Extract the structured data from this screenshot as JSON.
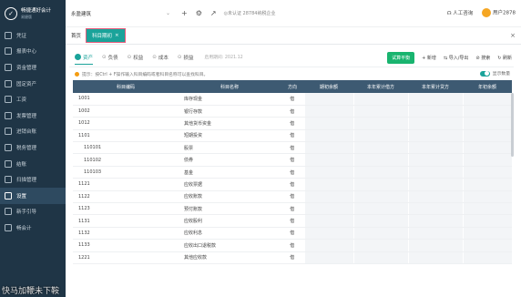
{
  "app": {
    "logo_title": "畅捷通好会计",
    "logo_sub": "易捷版"
  },
  "sidebar": {
    "items": [
      {
        "label": "凭证",
        "icon": "voucher-icon",
        "active": false
      },
      {
        "label": "报表中心",
        "icon": "report-icon",
        "active": false
      },
      {
        "label": "资金管理",
        "icon": "fund-icon",
        "active": false
      },
      {
        "label": "固定资产",
        "icon": "asset-icon",
        "active": false
      },
      {
        "label": "工资",
        "icon": "salary-icon",
        "active": false
      },
      {
        "label": "发票管理",
        "icon": "invoice-icon",
        "active": false
      },
      {
        "label": "进销台账",
        "icon": "ledger-icon",
        "active": false
      },
      {
        "label": "税务管理",
        "icon": "tax-icon",
        "active": false
      },
      {
        "label": "结账",
        "icon": "close-books-icon",
        "active": false
      },
      {
        "label": "扫描管理",
        "icon": "scan-icon",
        "active": false
      },
      {
        "label": "设置",
        "icon": "settings-icon",
        "active": true
      },
      {
        "label": "新手引导",
        "icon": "guide-icon",
        "active": false
      },
      {
        "label": "畅会计",
        "icon": "brand-icon",
        "active": false
      }
    ]
  },
  "topbar": {
    "company": "永盈建筑",
    "cert_text": "◎未认证 28784纳税企业",
    "support": "人工咨询",
    "user": "用户2878"
  },
  "tabs": {
    "home": "首页",
    "active": "科目期初",
    "close": "×"
  },
  "categories": {
    "items": [
      "资产",
      "负债",
      "权益",
      "成本",
      "损益"
    ],
    "active_index": 0,
    "period": "启用期间: 2021.12"
  },
  "actions": {
    "trial": "试算平衡",
    "add": "+ 新增",
    "import_export": "导入/导出",
    "search": "搜索",
    "refresh": "刷新"
  },
  "hint": {
    "text": "提示：按Ctrl + F操作输入科目编码或者科目名称可以查找科目。",
    "toggle_label": "显示数量"
  },
  "table": {
    "columns": [
      "科目编码",
      "科目名称",
      "方向",
      "期初余额",
      "本年累计借方",
      "本年累计贷方",
      "年初余额"
    ],
    "rows": [
      {
        "code": "1001",
        "name": "库存现金",
        "dir": "借"
      },
      {
        "code": "1002",
        "name": "银行存款",
        "dir": "借"
      },
      {
        "code": "1012",
        "name": "其他货币资金",
        "dir": "借"
      },
      {
        "code": "1101",
        "name": "短期投资",
        "dir": "借"
      },
      {
        "code": "110101",
        "name": "股票",
        "dir": "借"
      },
      {
        "code": "110102",
        "name": "债券",
        "dir": "借"
      },
      {
        "code": "110103",
        "name": "基金",
        "dir": "借"
      },
      {
        "code": "1121",
        "name": "应收票据",
        "dir": "借"
      },
      {
        "code": "1122",
        "name": "应收账款",
        "dir": "借"
      },
      {
        "code": "1123",
        "name": "预付账款",
        "dir": "借"
      },
      {
        "code": "1131",
        "name": "应收股利",
        "dir": "借"
      },
      {
        "code": "1132",
        "name": "应收利息",
        "dir": "借"
      },
      {
        "code": "1133",
        "name": "应收出口退税款",
        "dir": "借"
      },
      {
        "code": "1221",
        "name": "其他应收款",
        "dir": "借"
      }
    ]
  },
  "watermark": "快马加鞭未下鞍"
}
